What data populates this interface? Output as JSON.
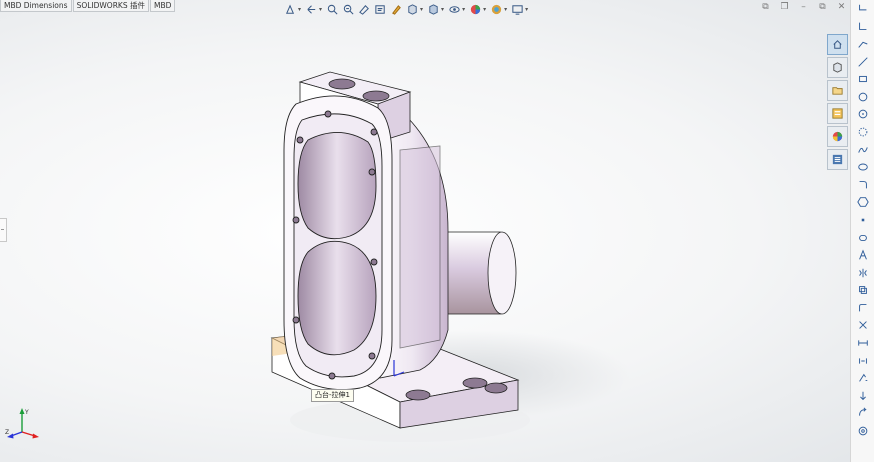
{
  "tabs": [
    {
      "label": "MBD Dimensions"
    },
    {
      "label": "SOLIDWORKS 插件"
    },
    {
      "label": "MBD"
    }
  ],
  "heads_up": [
    {
      "name": "view-orientation-icon",
      "caret": "▾"
    },
    {
      "name": "previous-view-icon",
      "caret": "▾"
    },
    {
      "name": "zoom-to-fit-icon",
      "caret": ""
    },
    {
      "name": "zoom-area-icon",
      "caret": ""
    },
    {
      "name": "section-view-icon",
      "caret": ""
    },
    {
      "name": "dynamic-annotation-icon",
      "caret": ""
    },
    {
      "name": "display-style-icon",
      "caret": ""
    },
    {
      "name": "standard-views-icon",
      "caret": "▾"
    },
    {
      "name": "view-cube-icon",
      "caret": "▾"
    },
    {
      "name": "hide-show-icon",
      "caret": "▾"
    },
    {
      "name": "appearance-icon",
      "caret": "▾"
    },
    {
      "name": "scene-icon",
      "caret": "▾"
    },
    {
      "name": "view-settings-icon",
      "caret": "▾"
    }
  ],
  "task_pane": [
    {
      "name": "home-icon",
      "active": true
    },
    {
      "name": "design-library-icon",
      "active": false
    },
    {
      "name": "file-explorer-icon",
      "active": false
    },
    {
      "name": "view-palette-icon",
      "active": false
    },
    {
      "name": "appearances-icon",
      "active": false
    },
    {
      "name": "custom-properties-icon",
      "active": false
    }
  ],
  "sketch_tools": [
    "bracket-icon",
    "corner-rect-icon",
    "polygon-line-icon",
    "line-icon",
    "rectangle-icon",
    "circle-icon",
    "circle-outline-icon",
    "dotted-arc-icon",
    "spline-icon",
    "ellipse-icon",
    "fillet-icon",
    "hexagon-icon",
    "point-icon",
    "slot-icon",
    "text-icon",
    "mirror-icon",
    "convert-entities-icon",
    "offset-icon",
    "trim-icon",
    "dimension-icon",
    "relation-icon",
    "quick-snap-icon",
    "anchor-icon",
    "rotate-icon",
    "target-icon"
  ],
  "tooltip": {
    "text": "凸台-拉伸1"
  },
  "triad": {
    "x": "X",
    "y": "Y",
    "z": "Z"
  },
  "colors": {
    "body": "#f3eef6",
    "body_shade": "#c9b7d0",
    "hole": "#8d7a92",
    "edge": "#222222",
    "axis_x": "#e02020",
    "axis_y": "#1b9e3a",
    "axis_z": "#2a35d8",
    "accent": "#4a78b0"
  }
}
